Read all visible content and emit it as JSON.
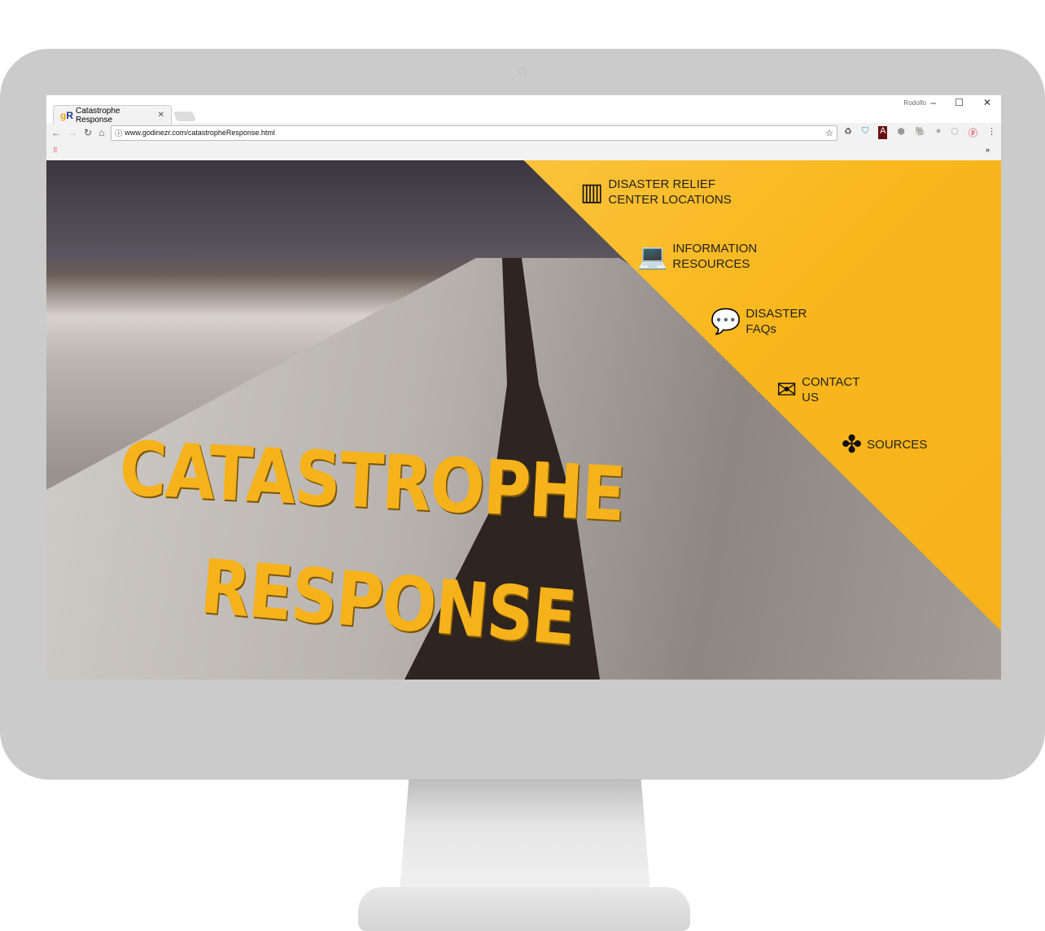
{
  "browser": {
    "tab_title": "Catastrophe Response",
    "favicon": "gR",
    "url": "www.godinezr.com/catastropheResponse.html",
    "user": "Rodolfo",
    "extensions": [
      "recycle-icon",
      "shield-check-icon",
      "acrobat-icon",
      "shield-icon",
      "evernote-icon",
      "circle-icon",
      "box-icon",
      "pinterest-icon"
    ],
    "more": "»"
  },
  "hero": {
    "title_line1": "CATASTROPHE",
    "title_line2": "RESPONSE",
    "accent": "#f9b71c"
  },
  "nav": [
    {
      "line1": "DISASTER RELIEF",
      "line2": "CENTER LOCATIONS",
      "icon": "map-icon"
    },
    {
      "line1": "INFORMATION",
      "line2": "RESOURCES",
      "icon": "laptop-icon"
    },
    {
      "line1": "DISASTER",
      "line2": "FAQs",
      "icon": "chat-question-icon"
    },
    {
      "line1": "CONTACT",
      "line2": "US",
      "icon": "envelope-icon"
    },
    {
      "line1": "SOURCES",
      "line2": "",
      "icon": "scatter-arrows-icon"
    }
  ]
}
